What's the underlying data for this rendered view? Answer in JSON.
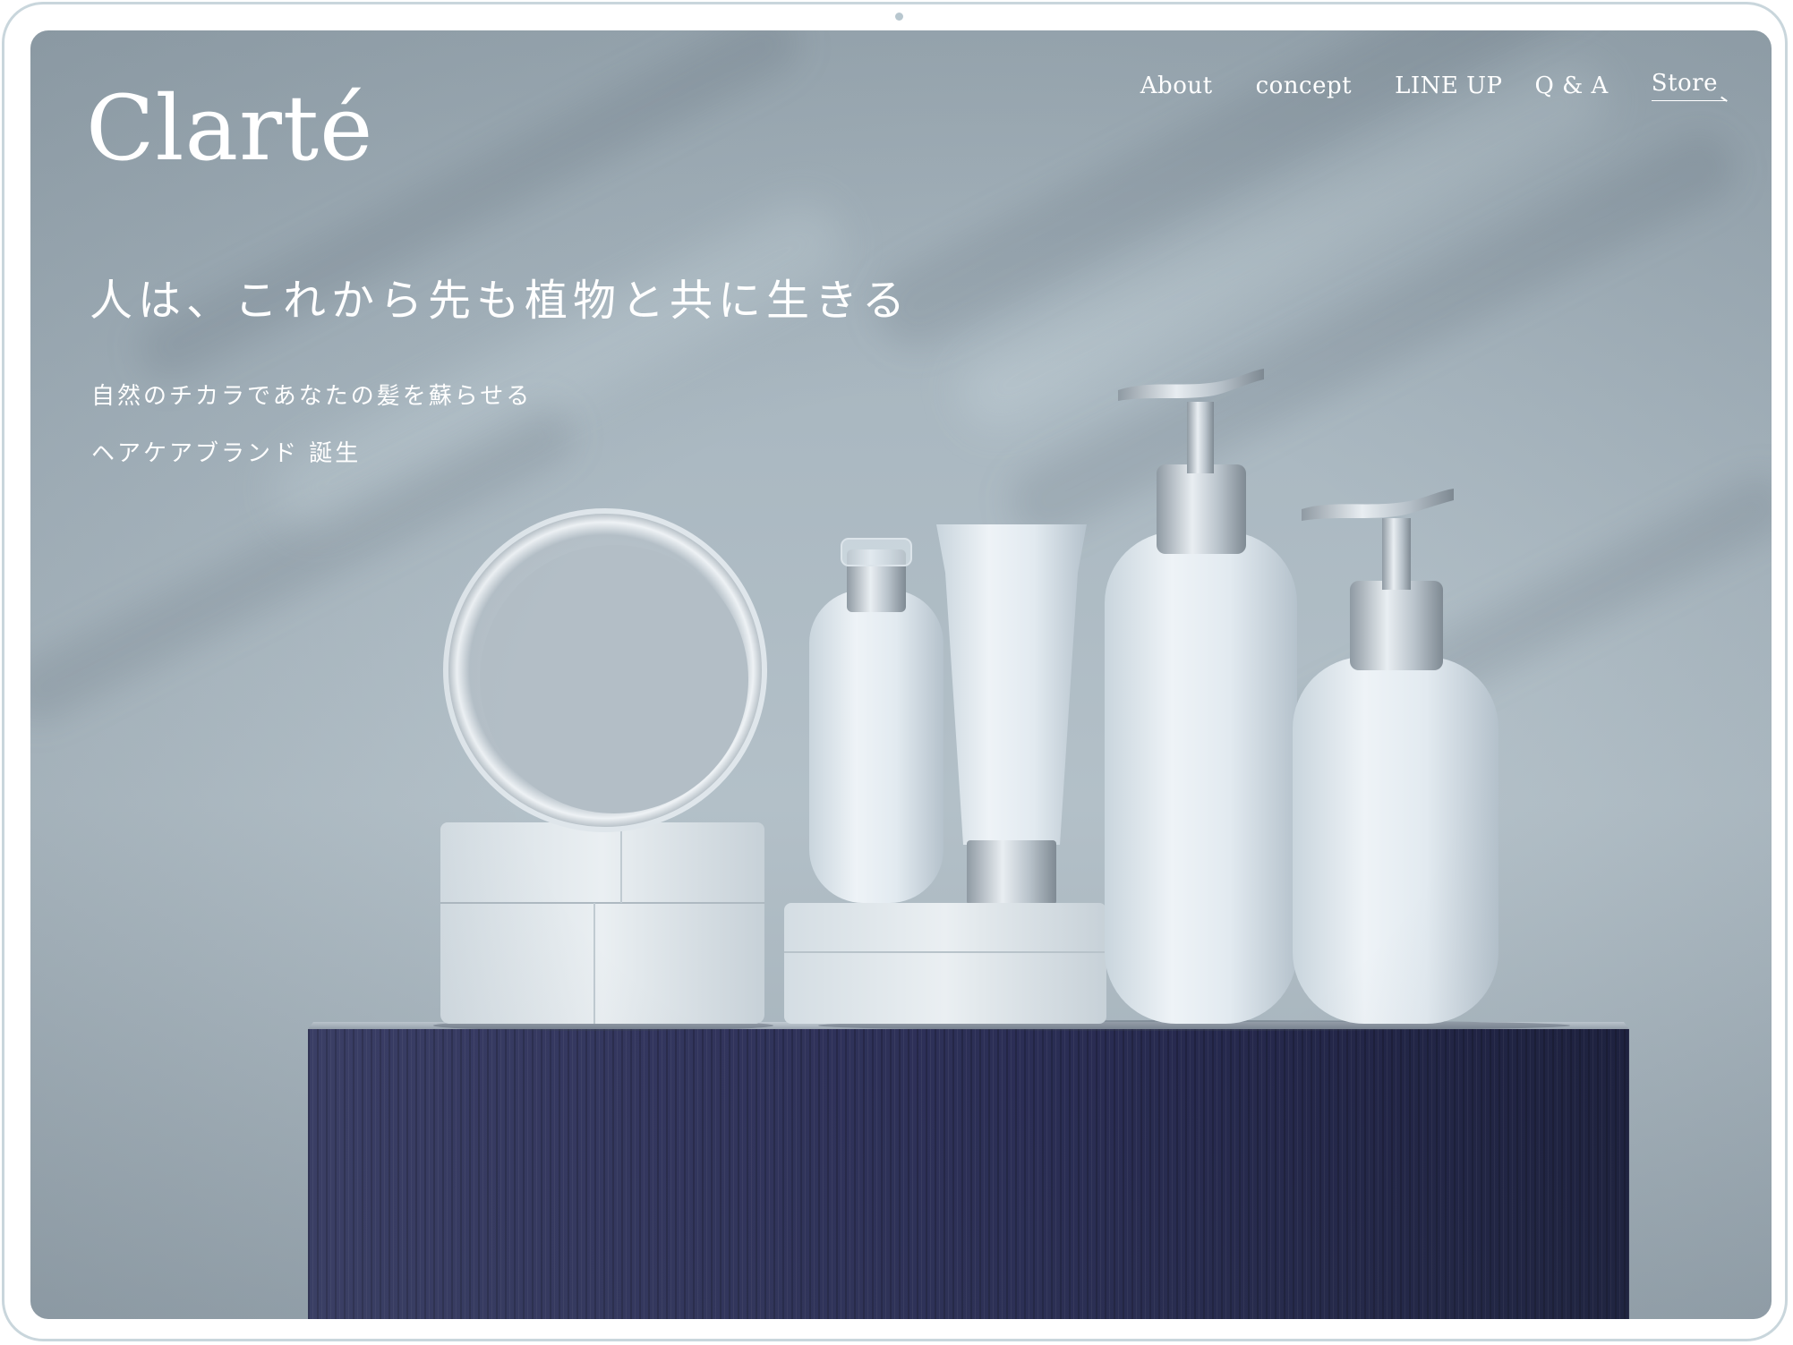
{
  "brand": {
    "logo_text": "Clarté"
  },
  "nav": {
    "items": [
      {
        "label": "About"
      },
      {
        "label": "concept"
      },
      {
        "label": "LINE UP"
      },
      {
        "label": "Q & A"
      }
    ],
    "store_label": "Store"
  },
  "hero": {
    "headline": "人は、これから先も植物と共に生きる",
    "subline_1": "自然のチカラであなたの髪を蘇らせる",
    "subline_2": "ヘアケアブランド 誕生"
  },
  "image": {
    "icon": "hair-care-product-photo"
  },
  "colors": {
    "background": "#a9b7c0",
    "text": "#ffffff",
    "pedestal": "#2e3158",
    "device_frame": "#c9d6dc"
  }
}
